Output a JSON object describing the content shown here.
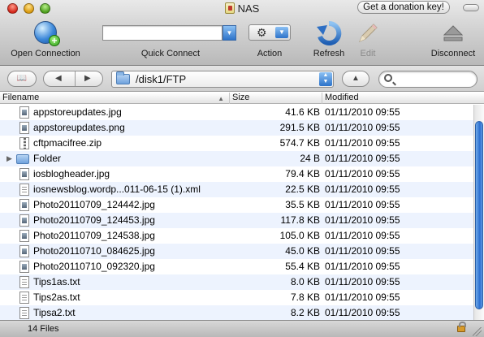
{
  "window": {
    "title": "NAS",
    "donation_label": "Get a donation key!"
  },
  "toolbar": {
    "open_connection": "Open Connection",
    "quick_connect": "Quick Connect",
    "quick_connect_value": "",
    "action": "Action",
    "refresh": "Refresh",
    "edit": "Edit",
    "disconnect": "Disconnect"
  },
  "pathbar": {
    "path": "/disk1/FTP",
    "search_value": ""
  },
  "columns": {
    "filename": "Filename",
    "size": "Size",
    "modified": "Modified"
  },
  "files": [
    {
      "name": "appstoreupdates.jpg",
      "size": "41.6 KB",
      "modified": "01/11/2010 09:55",
      "icon": "image-file-icon"
    },
    {
      "name": "appstoreupdates.png",
      "size": "291.5 KB",
      "modified": "01/11/2010 09:55",
      "icon": "image-file-icon"
    },
    {
      "name": "cftpmacifree.zip",
      "size": "574.7 KB",
      "modified": "01/11/2010 09:55",
      "icon": "zip-file-icon"
    },
    {
      "name": "Folder",
      "size": "24 B",
      "modified": "01/11/2010 09:55",
      "icon": "folder-icon"
    },
    {
      "name": "iosblogheader.jpg",
      "size": "79.4 KB",
      "modified": "01/11/2010 09:55",
      "icon": "image-file-icon"
    },
    {
      "name": "iosnewsblog.wordp...011-06-15 (1).xml",
      "size": "22.5 KB",
      "modified": "01/11/2010 09:55",
      "icon": "text-file-icon"
    },
    {
      "name": "Photo20110709_124442.jpg",
      "size": "35.5 KB",
      "modified": "01/11/2010 09:55",
      "icon": "image-file-icon"
    },
    {
      "name": "Photo20110709_124453.jpg",
      "size": "117.8 KB",
      "modified": "01/11/2010 09:55",
      "icon": "image-file-icon"
    },
    {
      "name": "Photo20110709_124538.jpg",
      "size": "105.0 KB",
      "modified": "01/11/2010 09:55",
      "icon": "image-file-icon"
    },
    {
      "name": "Photo20110710_084625.jpg",
      "size": "45.0 KB",
      "modified": "01/11/2010 09:55",
      "icon": "image-file-icon"
    },
    {
      "name": "Photo20110710_092320.jpg",
      "size": "55.4 KB",
      "modified": "01/11/2010 09:55",
      "icon": "image-file-icon"
    },
    {
      "name": "Tips1as.txt",
      "size": "8.0 KB",
      "modified": "01/11/2010 09:55",
      "icon": "text-file-icon"
    },
    {
      "name": "Tips2as.txt",
      "size": "7.8 KB",
      "modified": "01/11/2010 09:55",
      "icon": "text-file-icon"
    },
    {
      "name": "Tipsa2.txt",
      "size": "8.2 KB",
      "modified": "01/11/2010 09:55",
      "icon": "text-file-icon"
    }
  ],
  "status": {
    "file_count": "14 Files"
  }
}
